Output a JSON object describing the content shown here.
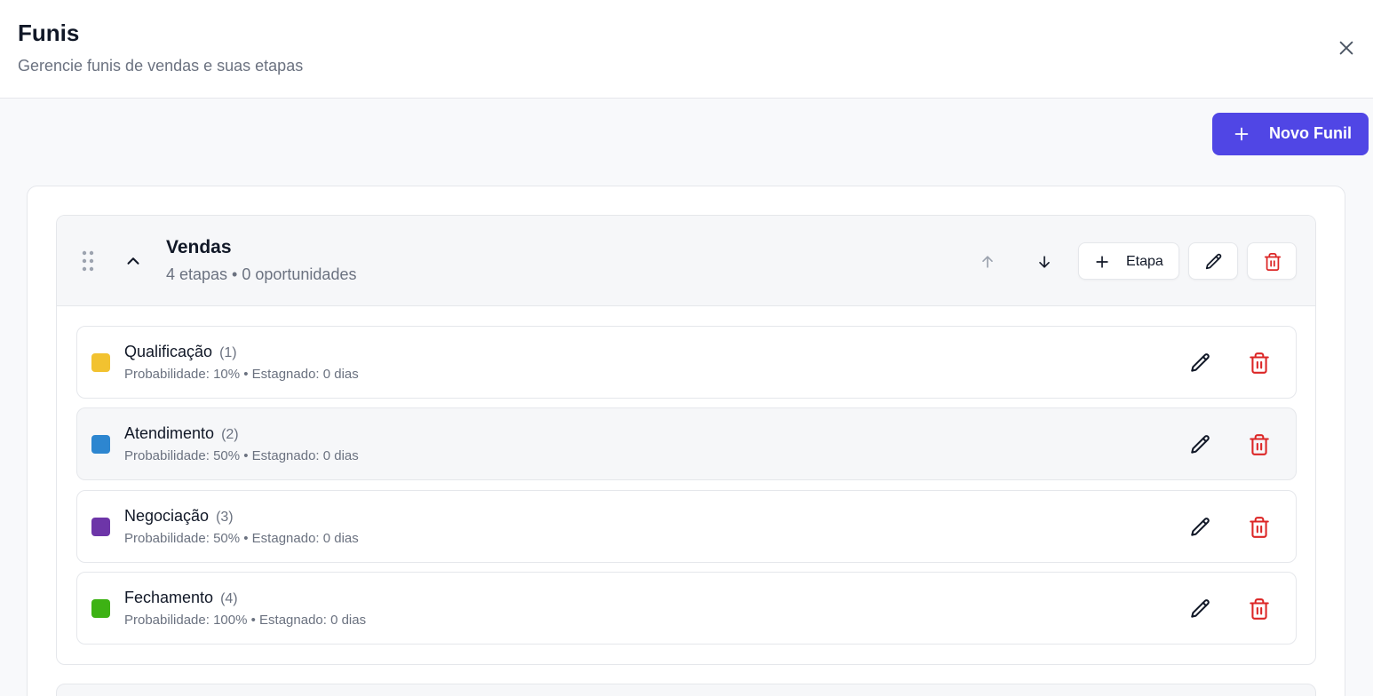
{
  "header": {
    "title": "Funis",
    "subtitle": "Gerencie funis de vendas e suas etapas"
  },
  "new_funnel_button": {
    "label": "Novo Funil"
  },
  "colors": {
    "accent": "#5046e5",
    "danger": "#dc2626"
  },
  "funnels": [
    {
      "name": "Vendas",
      "meta": "4 etapas • 0 oportunidades",
      "add_stage_label": "Etapa",
      "stages": [
        {
          "name": "Qualificação",
          "count": "(1)",
          "details": "Probabilidade: 10% • Estagnado: 0 dias",
          "color": "#f2c230"
        },
        {
          "name": "Atendimento",
          "count": "(2)",
          "details": "Probabilidade: 50% • Estagnado: 0 dias",
          "color": "#2d86d0"
        },
        {
          "name": "Negociação",
          "count": "(3)",
          "details": "Probabilidade: 50% • Estagnado: 0 dias",
          "color": "#6d35a8"
        },
        {
          "name": "Fechamento",
          "count": "(4)",
          "details": "Probabilidade: 100% • Estagnado: 0 dias",
          "color": "#3db214"
        }
      ]
    }
  ]
}
